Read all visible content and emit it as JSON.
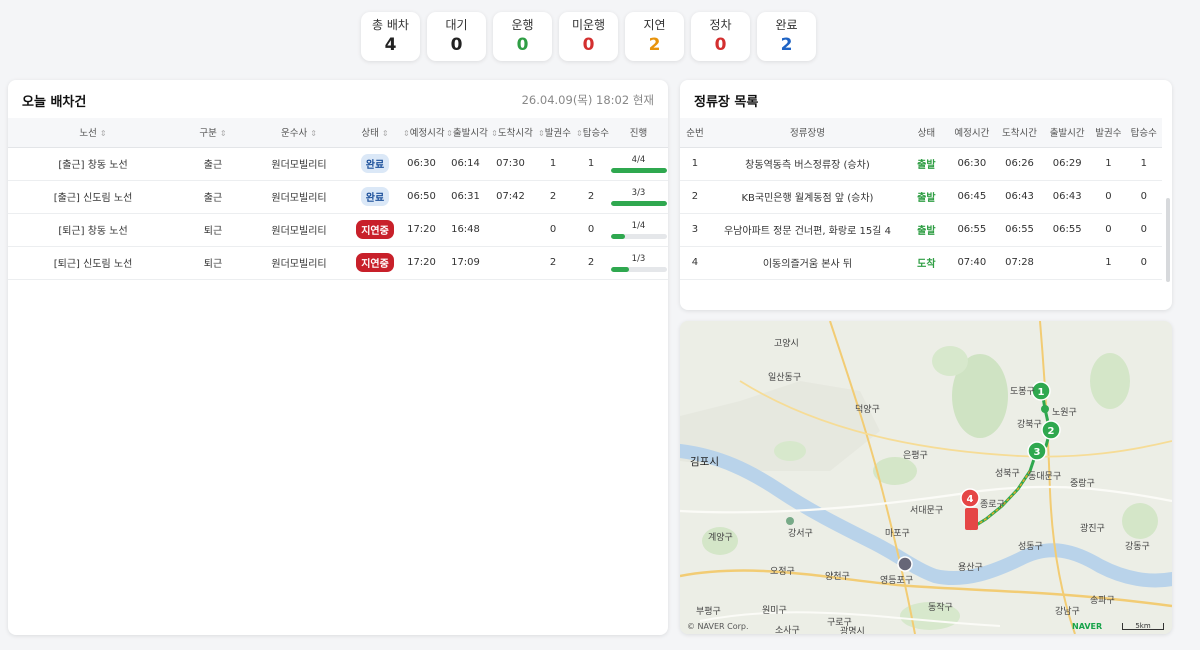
{
  "summary": [
    {
      "label": "총 배차",
      "value": "4",
      "color": "#222222"
    },
    {
      "label": "대기",
      "value": "0",
      "color": "#222222"
    },
    {
      "label": "운행",
      "value": "0",
      "color": "#2f9e44"
    },
    {
      "label": "미운행",
      "value": "0",
      "color": "#d32f2f"
    },
    {
      "label": "지연",
      "value": "2",
      "color": "#e8930c"
    },
    {
      "label": "정차",
      "value": "0",
      "color": "#d32f2f"
    },
    {
      "label": "완료",
      "value": "2",
      "color": "#1e63c4"
    }
  ],
  "dispatch": {
    "title": "오늘 배차건",
    "datetime": "26.04.09(목) 18:02 현재",
    "columns": [
      "노선",
      "구분",
      "운수사",
      "상태",
      "예정시각",
      "출발시각",
      "도착시각",
      "발권수",
      "탑승수",
      "진행"
    ],
    "rows": [
      {
        "route": "[출근] 창동 노선",
        "type": "출근",
        "company": "원더모빌리티",
        "status": "완료",
        "status_kind": "done",
        "scheduled": "06:30",
        "departed": "06:14",
        "arrived": "07:30",
        "tickets": "1",
        "boarded": "1",
        "progress": "4/4",
        "progress_ratio": 1.0
      },
      {
        "route": "[출근] 신도림 노선",
        "type": "출근",
        "company": "원더모빌리티",
        "status": "완료",
        "status_kind": "done",
        "scheduled": "06:50",
        "departed": "06:31",
        "arrived": "07:42",
        "tickets": "2",
        "boarded": "2",
        "progress": "3/3",
        "progress_ratio": 1.0
      },
      {
        "route": "[퇴근] 창동 노선",
        "type": "퇴근",
        "company": "원더모빌리티",
        "status": "지연중",
        "status_kind": "delay",
        "scheduled": "17:20",
        "departed": "16:48",
        "arrived": "",
        "tickets": "0",
        "boarded": "0",
        "progress": "1/4",
        "progress_ratio": 0.25
      },
      {
        "route": "[퇴근] 신도림 노선",
        "type": "퇴근",
        "company": "원더모빌리티",
        "status": "지연중",
        "status_kind": "delay",
        "scheduled": "17:20",
        "departed": "17:09",
        "arrived": "",
        "tickets": "2",
        "boarded": "2",
        "progress": "1/3",
        "progress_ratio": 0.33
      }
    ]
  },
  "stops": {
    "title": "정류장 목록",
    "columns": [
      "순번",
      "정류장명",
      "상태",
      "예정시간",
      "도착시간",
      "출발시간",
      "발권수",
      "탑승수"
    ],
    "rows": [
      {
        "seq": "1",
        "name": "창동역동측 버스정류장 (승차)",
        "status": "출발",
        "scheduled": "06:30",
        "arrived": "06:26",
        "departed": "06:29",
        "tickets": "1",
        "boarded": "1"
      },
      {
        "seq": "2",
        "name": "KB국민은행 월계동점 앞 (승차)",
        "status": "출발",
        "scheduled": "06:45",
        "arrived": "06:43",
        "departed": "06:43",
        "tickets": "0",
        "boarded": "0"
      },
      {
        "seq": "3",
        "name": "우남아파트 정문 건너편, 화랑로 15길 4",
        "status": "출발",
        "scheduled": "06:55",
        "arrived": "06:55",
        "departed": "06:55",
        "tickets": "0",
        "boarded": "0"
      },
      {
        "seq": "4",
        "name": "이동의즐거움 본사 뒤",
        "status": "도착",
        "scheduled": "07:40",
        "arrived": "07:28",
        "departed": "",
        "tickets": "1",
        "boarded": "0"
      }
    ]
  },
  "map": {
    "labels": [
      {
        "text": "고양시",
        "big": false
      },
      {
        "text": "일산동구",
        "big": false
      },
      {
        "text": "덕양구",
        "big": false
      },
      {
        "text": "도봉구",
        "big": false
      },
      {
        "text": "노원구",
        "big": false
      },
      {
        "text": "강북구",
        "big": false
      },
      {
        "text": "김포시",
        "big": true
      },
      {
        "text": "은평구",
        "big": false
      },
      {
        "text": "성북구",
        "big": false
      },
      {
        "text": "중랑구",
        "big": false
      },
      {
        "text": "동대문구",
        "big": false
      },
      {
        "text": "서대문구",
        "big": false
      },
      {
        "text": "종로구",
        "big": false
      },
      {
        "text": "마포구",
        "big": false
      },
      {
        "text": "계양구",
        "big": false
      },
      {
        "text": "강서구",
        "big": false
      },
      {
        "text": "성동구",
        "big": false
      },
      {
        "text": "광진구",
        "big": false
      },
      {
        "text": "강동구",
        "big": false
      },
      {
        "text": "용산구",
        "big": false
      },
      {
        "text": "양천구",
        "big": false
      },
      {
        "text": "영등포구",
        "big": false
      },
      {
        "text": "부평구",
        "big": false
      },
      {
        "text": "원미구",
        "big": false
      },
      {
        "text": "구로구",
        "big": false
      },
      {
        "text": "동작구",
        "big": false
      },
      {
        "text": "강남구",
        "big": false
      },
      {
        "text": "송파구",
        "big": false
      },
      {
        "text": "소사구",
        "big": false
      },
      {
        "text": "광명시",
        "big": false
      },
      {
        "text": "오정구",
        "big": false
      }
    ],
    "markers": [
      "1",
      "2",
      "3",
      "4"
    ],
    "copyright": "© NAVER Corp.",
    "brand": "NAVER",
    "scale": "5km"
  }
}
